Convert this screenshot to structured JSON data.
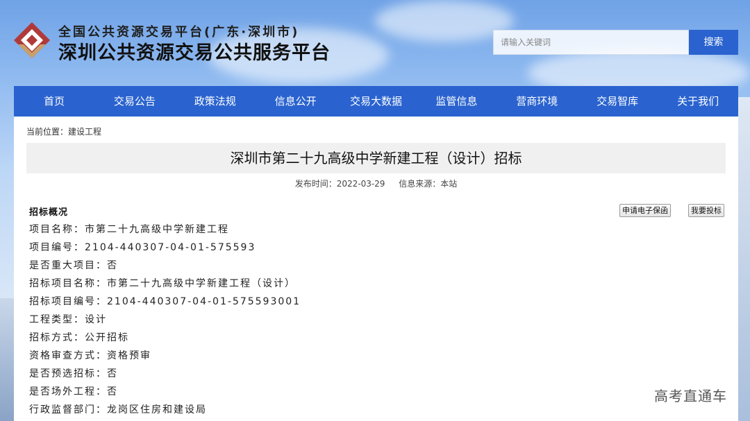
{
  "header": {
    "title_small": "全国公共资源交易平台(广东·深圳市)",
    "title_big": "深圳公共资源交易公共服务平台"
  },
  "search": {
    "placeholder": "请输入关键词",
    "button_label": "搜索"
  },
  "nav": {
    "items": [
      "首页",
      "交易公告",
      "政策法规",
      "信息公开",
      "交易大数据",
      "监管信息",
      "营商环境",
      "交易智库",
      "关于我们"
    ]
  },
  "breadcrumb": "当前位置：建设工程",
  "article": {
    "title": "深圳市第二十九高级中学新建工程（设计）招标",
    "publish_time": "发布时间：2022-03-29",
    "source": "信息来源：本站",
    "section_title": "招标概况",
    "apply_bond_label": "申请电子保函",
    "bid_label": "我要投标",
    "fields": [
      "项目名称：市第二十九高级中学新建工程",
      "项目编号：2104-440307-04-01-575593",
      "是否重大项目：否",
      "招标项目名称：市第二十九高级中学新建工程（设计）",
      "招标项目编号：2104-440307-04-01-575593001",
      "工程类型：设计",
      "招标方式：公开招标",
      "资格审查方式：资格预审",
      "是否预选招标：否",
      "是否场外工程：否",
      "行政监督部门：龙岗区住房和建设局"
    ]
  },
  "watermark": "高考直通车",
  "colors": {
    "brand_blue": "#2a63cf",
    "logo_red": "#b03a3a"
  }
}
